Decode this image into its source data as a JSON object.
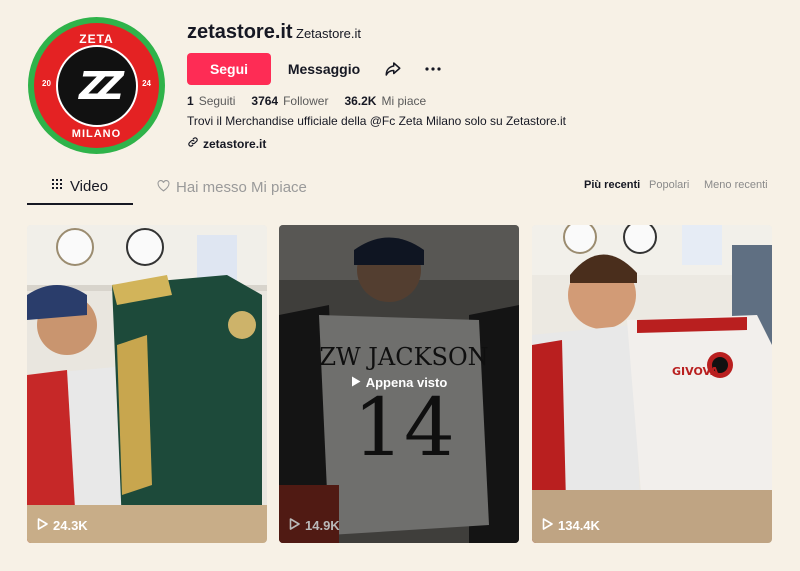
{
  "profile": {
    "username": "zetastore.it",
    "nickname": "Zetastore.it",
    "avatar_top": "ZETA",
    "avatar_bottom": "MILANO",
    "avatar_year_left": "20",
    "avatar_year_right": "24",
    "avatar_mark": "ZZ",
    "follow_label": "Segui",
    "message_label": "Messaggio",
    "stats": [
      {
        "value": "1",
        "label": "Seguiti"
      },
      {
        "value": "3764",
        "label": "Follower"
      },
      {
        "value": "36.2K",
        "label": "Mi piace"
      }
    ],
    "bio": "Trovi il Merchandise ufficiale della @Fc Zeta Milano solo su Zetastore.it",
    "link": "zetastore.it"
  },
  "tabs": {
    "video": "Video",
    "liked": "Hai messo Mi piace"
  },
  "sort": {
    "recent": "Più recenti",
    "popular": "Popolari",
    "less_recent": "Meno recenti"
  },
  "videos": [
    {
      "views": "24.3K"
    },
    {
      "views": "14.9K",
      "overlay": "Appena visto"
    },
    {
      "views": "134.4K"
    }
  ],
  "colors": {
    "accent": "#fe2c55",
    "background": "#f7f1e6",
    "badge_green": "#2fb34a",
    "badge_red": "#e42223"
  }
}
